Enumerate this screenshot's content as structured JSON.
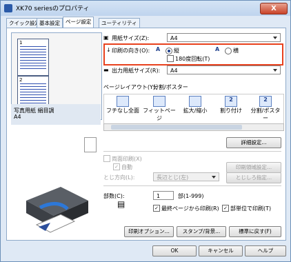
{
  "window": {
    "title": "XK70 seriesのプロパティ",
    "close_label": "X"
  },
  "tabs": [
    "クイック設定",
    "基本設定",
    "ページ設定",
    "ユーティリティ"
  ],
  "preview": {
    "page_numbers": [
      "1",
      "2"
    ],
    "paper_info_line1": "写真用紙 絹目調",
    "paper_info_line2": "A4"
  },
  "page_size": {
    "label": "用紙サイズ(Z):",
    "value": "A4"
  },
  "orientation": {
    "label": "印刷の向き(O):",
    "portrait_label": "縦",
    "landscape_label": "横",
    "rotate_label": "180度回転(T)"
  },
  "output_size": {
    "label": "出力用紙サイズ(R):",
    "value": "A4"
  },
  "page_layout": {
    "label": "ページレイアウト(Y):",
    "value": "分割/ポスター",
    "items": [
      "フチなし全面",
      "フィットページ",
      "拡大/縮小",
      "割り付け",
      "分割/ポスター"
    ],
    "item_numbers": [
      "2",
      "2"
    ]
  },
  "detail_button": "詳細設定...",
  "duplex": {
    "label": "両面印刷(X)",
    "auto_label": "自動",
    "area_button": "印刷領域設定..."
  },
  "binding": {
    "label": "とじ方向(L):",
    "value": "長辺とじ(左)",
    "margin_button": "とじしろ指定..."
  },
  "copies": {
    "label": "部数(C):",
    "value": "1",
    "unit": "部(1-999)",
    "reverse_label": "最終ページから印刷(R)",
    "collate_label": "部単位で印刷(T)"
  },
  "buttons": {
    "print_options": "印刷オプション...",
    "stamp": "スタンプ/背景...",
    "defaults": "標準に戻す(F)",
    "ok": "OK",
    "cancel": "キャンセル",
    "help": "ヘルプ"
  }
}
